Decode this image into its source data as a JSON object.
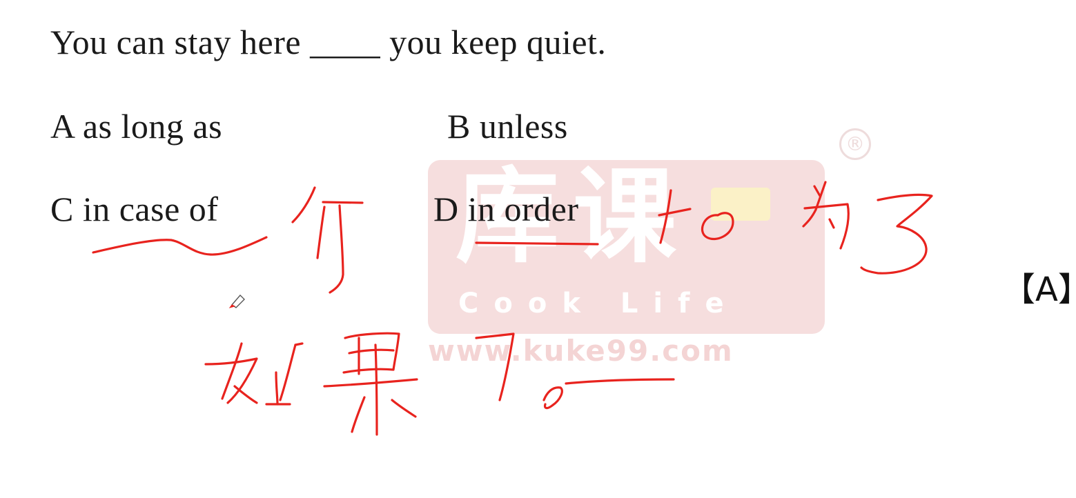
{
  "question": {
    "text": "You can stay here ____ you keep quiet.",
    "options": {
      "a": "A as long as",
      "b": "B unless",
      "c": "C in case of",
      "d": "D in order"
    },
    "answer": "【A】"
  },
  "watermark": {
    "logo_text": "库课",
    "brand_en": "Cook Life",
    "url": "www.kuke99.com",
    "registered": "®"
  },
  "annotations": {
    "ink_color": "#e8231e",
    "handwritten_notes": [
      "万一",
      "如果",
      "为了",
      "to"
    ]
  },
  "icons": {
    "pen": "pen-cursor-icon"
  }
}
